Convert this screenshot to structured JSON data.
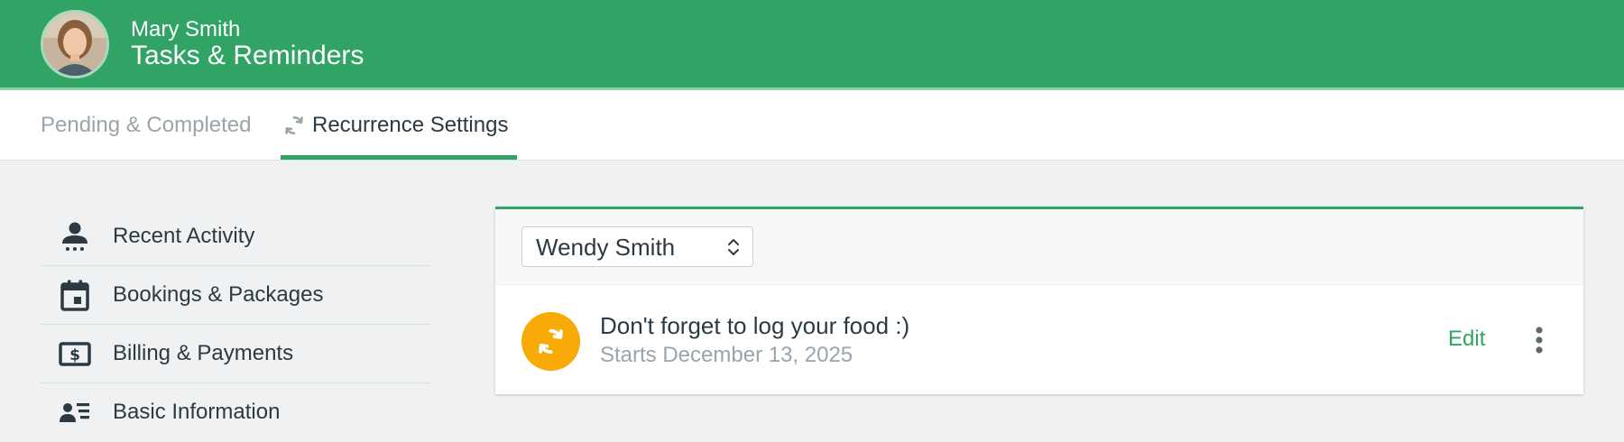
{
  "header": {
    "user_name": "Mary Smith",
    "app_title": "Tasks & Reminders",
    "avatar_icon": "user-photo-avatar"
  },
  "tabs": [
    {
      "label": "Pending & Completed",
      "active": false
    },
    {
      "label": "Recurrence Settings",
      "active": true,
      "icon": "recurrence-icon"
    }
  ],
  "sidebar": {
    "items": [
      {
        "label": "Recent Activity",
        "icon": "person-activity-icon"
      },
      {
        "label": "Bookings & Packages",
        "icon": "calendar-icon"
      },
      {
        "label": "Billing & Payments",
        "icon": "dollar-bill-icon"
      },
      {
        "label": "Basic Information",
        "icon": "contact-card-icon"
      }
    ]
  },
  "filter": {
    "client_value": "Wendy Smith"
  },
  "reminders": [
    {
      "title": "Don't forget to log your food :)",
      "subtitle": "Starts December 13, 2025",
      "edit_label": "Edit",
      "icon": "recurrence-icon",
      "more_icon": "vertical-ellipsis-icon"
    }
  ],
  "colors": {
    "brand_green": "#31a365",
    "badge_orange": "#f8aa07",
    "text_dark": "#2b3a42",
    "text_muted": "#9aa4a9",
    "background": "#f0f1f2"
  }
}
